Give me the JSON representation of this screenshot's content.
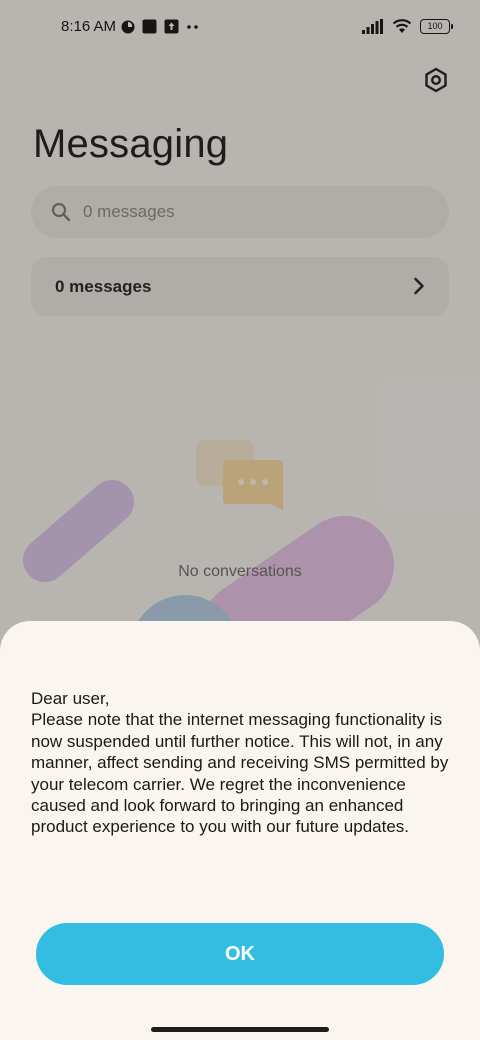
{
  "status_bar": {
    "time": "8:16 AM",
    "left_icons": [
      "app-notification-icon",
      "square-notification-icon",
      "upload-notification-icon",
      "more-dots-icon"
    ],
    "right_icons": [
      "signal-icon",
      "wifi-icon",
      "battery-icon"
    ],
    "battery_level": "100"
  },
  "header": {
    "title": "Messaging",
    "settings_icon": "gear-icon"
  },
  "search": {
    "placeholder": "0 messages",
    "icon": "search-icon"
  },
  "messages_row": {
    "label": "0 messages",
    "icon": "chevron-right-icon"
  },
  "empty_state": {
    "label": "No conversations",
    "icon": "chat-bubble-icon"
  },
  "dialog": {
    "message": "Dear user,\nPlease note that the internet messaging functionality is now suspended until further notice. This will not, in any manner, affect sending and receiving SMS permitted by your telecom carrier. We regret the inconvenience caused and look forward to bringing an enhanced product experience to you with our future updates.",
    "ok_label": "OK"
  },
  "colors": {
    "accent": "#33bde3",
    "sheet_background": "#faf6ef",
    "app_background": "#f6f4f0"
  }
}
